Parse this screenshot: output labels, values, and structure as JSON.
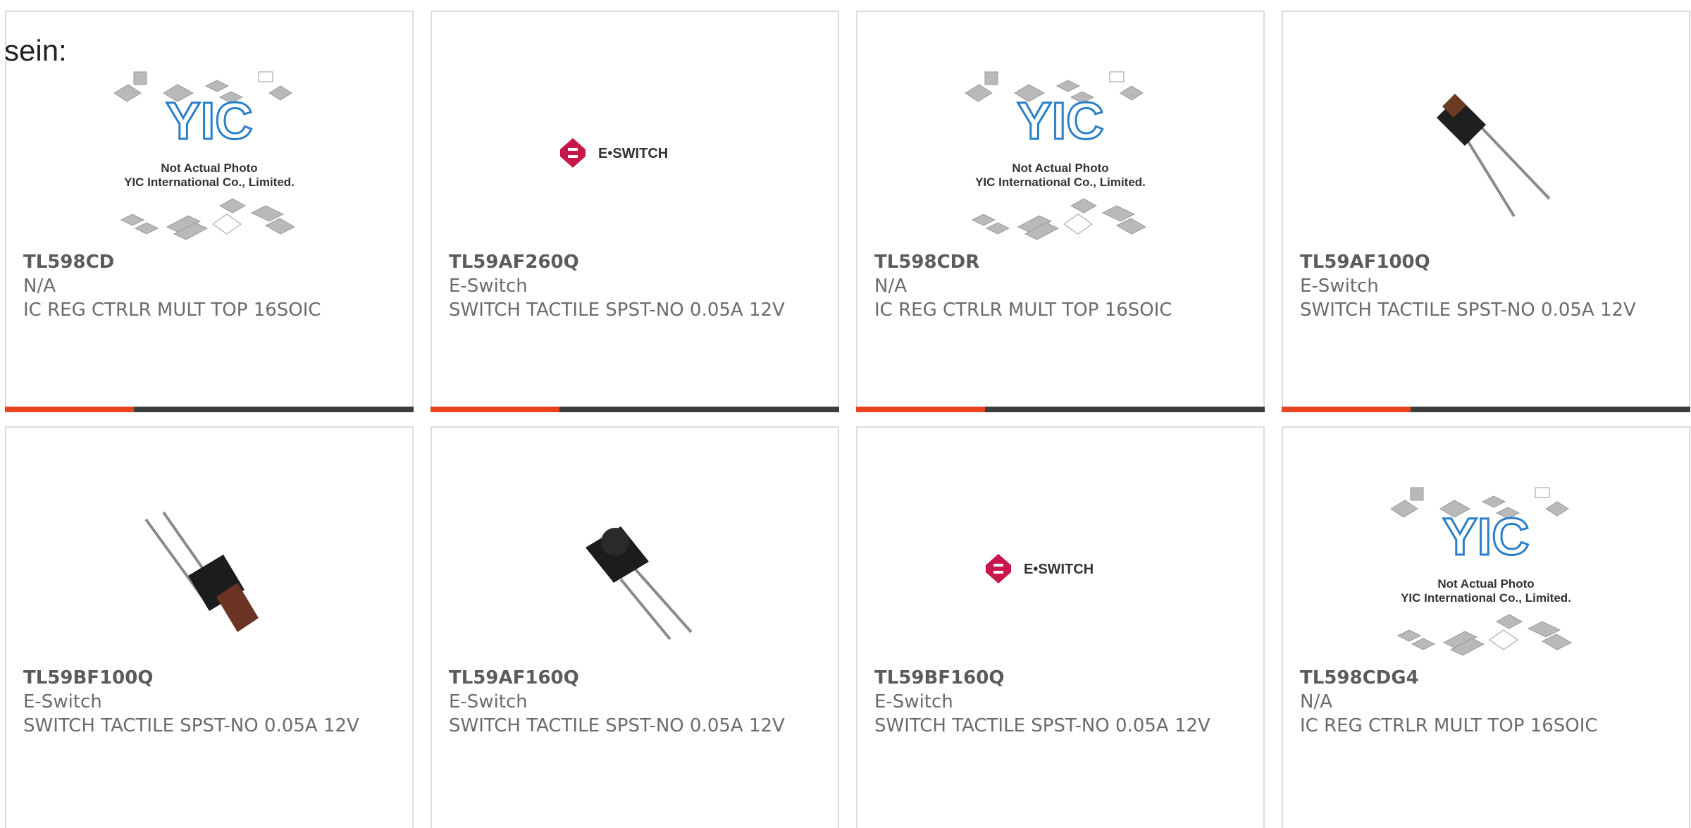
{
  "stray_label": "sein:",
  "colors": {
    "accent": "#e8431b",
    "bar": "#3e3e3e",
    "eswitch": "#c8154a",
    "yic_blue": "#2a7fc9"
  },
  "placeholder": {
    "line1": "Not Actual Photo",
    "line2": "YIC International Co., Limited.",
    "logo": "YIC"
  },
  "eswitch_logo_text": "E•SWITCH",
  "products": [
    {
      "part": "TL598CD",
      "manufacturer": "N/A",
      "description": "IC REG CTRLR MULT TOP 16SOIC",
      "image": "yic-placeholder"
    },
    {
      "part": "TL59AF260Q",
      "manufacturer": "E-Switch",
      "description": "SWITCH TACTILE SPST-NO 0.05A 12V",
      "image": "eswitch-logo"
    },
    {
      "part": "TL598CDR",
      "manufacturer": "N/A",
      "description": "IC REG CTRLR MULT TOP 16SOIC",
      "image": "yic-placeholder"
    },
    {
      "part": "TL59AF100Q",
      "manufacturer": "E-Switch",
      "description": "SWITCH TACTILE SPST-NO 0.05A 12V",
      "image": "tactile-switch-angled"
    },
    {
      "part": "TL59BF100Q",
      "manufacturer": "E-Switch",
      "description": "SWITCH TACTILE SPST-NO 0.05A 12V",
      "image": "tactile-switch-brown"
    },
    {
      "part": "TL59AF160Q",
      "manufacturer": "E-Switch",
      "description": "SWITCH TACTILE SPST-NO 0.05A 12V",
      "image": "tactile-switch-black"
    },
    {
      "part": "TL59BF160Q",
      "manufacturer": "E-Switch",
      "description": "SWITCH TACTILE SPST-NO 0.05A 12V",
      "image": "eswitch-logo"
    },
    {
      "part": "TL598CDG4",
      "manufacturer": "N/A",
      "description": "IC REG CTRLR MULT TOP 16SOIC",
      "image": "yic-placeholder"
    }
  ]
}
